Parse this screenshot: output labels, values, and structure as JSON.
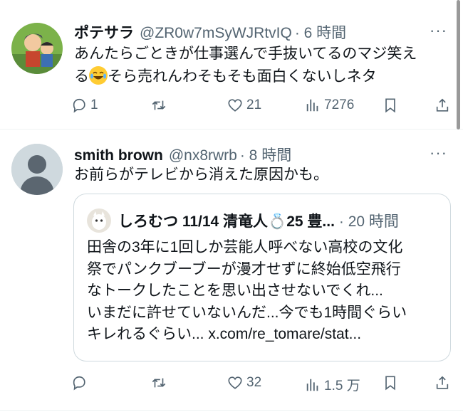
{
  "tweets": [
    {
      "display_name": "ポテサラ",
      "handle": "@ZR0w7mSyWJRtvIQ",
      "time": "· 6 時間",
      "more": "···",
      "text_line1": "あんたらごときが仕事選んで手抜いてるのマジ笑え",
      "text_line2_pre": "る",
      "emoji": "face-with-tears-of-joy",
      "text_line2_post": "そら売れんわそもそも面白くないしネタ",
      "replies": "1",
      "retweets": "",
      "likes": "21",
      "views": "7276"
    },
    {
      "display_name": "smith brown",
      "handle": "@nx8rwrb",
      "time": "· 8 時間",
      "more": "···",
      "text": "お前らがテレビから消えた原因かも。",
      "replies": "",
      "retweets": "",
      "likes": "32",
      "views": "1.5 万",
      "quote": {
        "display_name": "しろむつ 11/14 清竜人💍25 豊...",
        "time": "· 20 時間",
        "text": "田舎の3年に1回しか芸能人呼べない高校の文化\n祭でパンクブーブーが漫才せずに終始低空飛行\nなトークしたことを思い出させないでくれ...\nいまだに許せていないんだ...今でも1時間ぐらい\nキレれるぐらい... x.com/re_tomare/stat..."
      }
    }
  ],
  "colors": {
    "text": "#0f1419",
    "secondary": "#536471",
    "border": "#cfd9de"
  }
}
